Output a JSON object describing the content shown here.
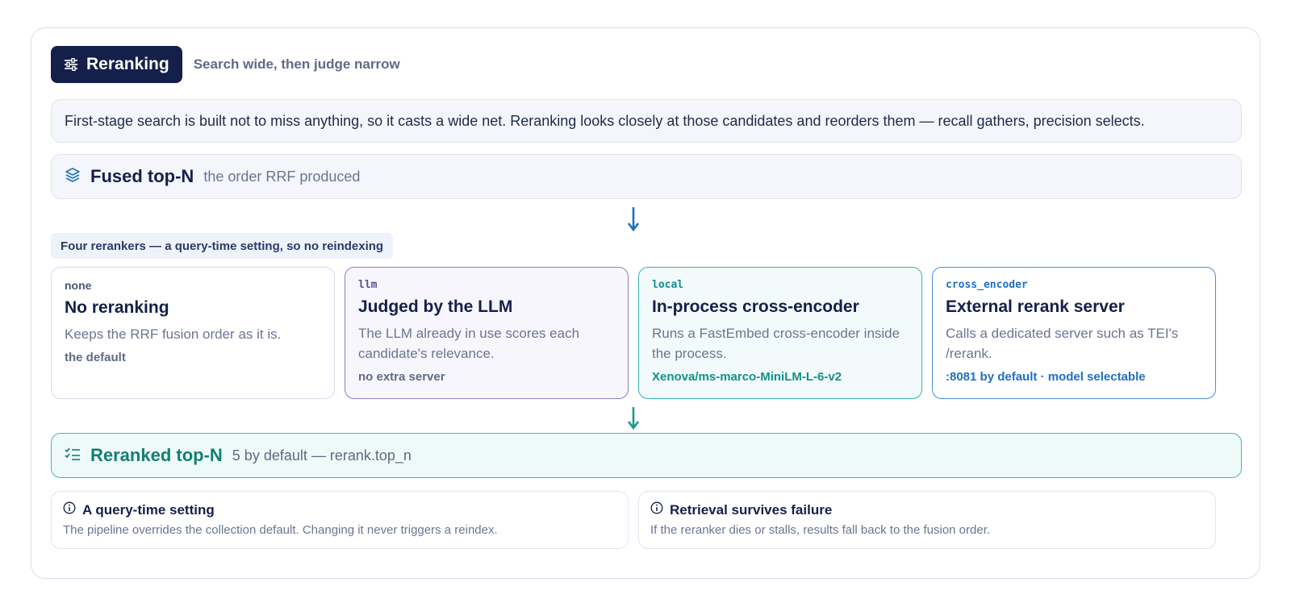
{
  "header": {
    "badge_label": "Reranking",
    "badge_icon": "sliders-icon",
    "subtitle": "Search wide, then judge narrow"
  },
  "intro": "First-stage search is built not to miss anything, so it casts a wide net. Reranking looks closely at those candidates and reorders them — recall gathers, precision selects.",
  "fused": {
    "icon": "layers-icon",
    "title": "Fused top-N",
    "subtitle": "the order RRF produced"
  },
  "rerankers_tag": "Four rerankers — a query-time setting, so no reindexing",
  "rerankers": [
    {
      "code": "none",
      "name": "No reranking",
      "description": "Keeps the RRF fusion order as it is.",
      "note": "the default"
    },
    {
      "code": "llm",
      "name": "Judged by the LLM",
      "description": "The LLM already in use scores each candidate's relevance.",
      "note": "no extra server"
    },
    {
      "code": "local",
      "name": "In-process cross-encoder",
      "description": "Runs a FastEmbed cross-encoder inside the process.",
      "note": "Xenova/ms-marco-MiniLM-L-6-v2"
    },
    {
      "code": "cross_encoder",
      "name": "External rerank server",
      "description": "Calls a dedicated server such as TEI's /rerank.",
      "note": ":8081 by default · model selectable"
    }
  ],
  "reranked": {
    "icon": "checklist-icon",
    "title": "Reranked top-N",
    "subtitle": "5 by default — rerank.top_n"
  },
  "notes": [
    {
      "icon": "info-icon",
      "title": "A query-time setting",
      "text": "The pipeline overrides the collection default. Changing it never triggers a reindex."
    },
    {
      "icon": "info-icon",
      "title": "Retrieval survives failure",
      "text": "If the reranker dies or stalls, results fall back to the fusion order."
    }
  ],
  "colors": {
    "navy": "#14204a",
    "blue_arrow": "#1f6fc4",
    "teal": "#137f72",
    "purple_border": "#8c7fc4"
  }
}
